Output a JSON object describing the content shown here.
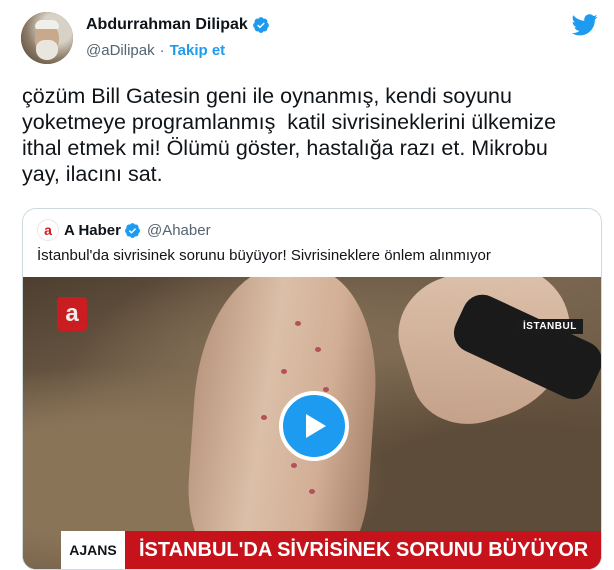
{
  "author": {
    "name": "Abdurrahman Dilipak",
    "handle": "@aDilipak",
    "separator": "·",
    "follow_label": "Takip et"
  },
  "tweet": {
    "text": "çözüm Bill Gatesin geni ile oynanmış, kendi soyunu\nyoketmeye programlanmış  katil sivrisineklerini ülkemize\nithal etmek mi! Ölümü göster, hastalığa razı et. Mikrobu\nyay, ilacını sat."
  },
  "quoted": {
    "logo_letter": "a",
    "name": "A Haber",
    "handle": "@Ahaber",
    "text": "İstanbul'da sivrisinek sorunu büyüyor! Sivrisineklere önlem alınmıyor",
    "video": {
      "location_tag": "İSTANBUL",
      "channel_bug": "a",
      "ticker_left": "AJANS",
      "ticker_headline": "İSTANBUL'DA SİVRİSİNEK SORUNU BÜYÜYOR"
    }
  },
  "colors": {
    "accent": "#1d9bf0",
    "text": "#0f1419",
    "muted": "#536471",
    "border": "#cfd9de",
    "ticker_red": "#c5121b"
  },
  "icons": [
    "twitter-bird-icon",
    "verified-badge-icon",
    "play-icon"
  ]
}
